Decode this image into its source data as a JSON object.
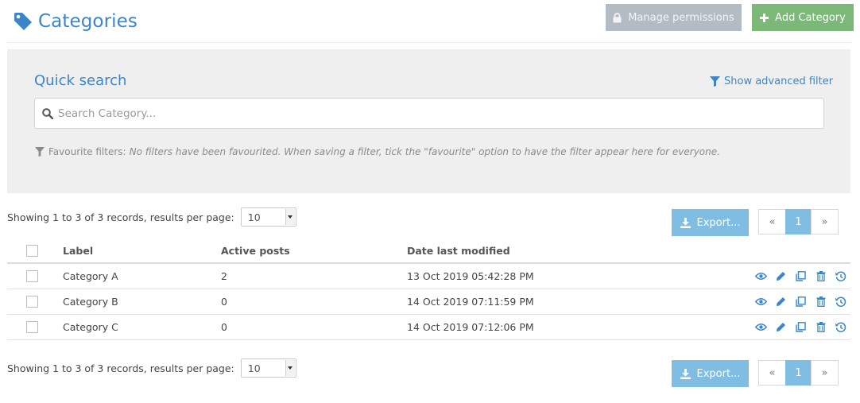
{
  "header": {
    "title": "Categories",
    "manage_permissions_label": "Manage permissions",
    "add_category_label": "Add Category"
  },
  "quick_search": {
    "title": "Quick search",
    "advanced_filter_label": "Show advanced filter",
    "search_placeholder": "Search Category...",
    "search_value": "",
    "favourite_label": "Favourite filters:",
    "favourite_text": "No filters have been favourited. When saving a filter, tick the \"favourite\" option to have the filter appear here for everyone."
  },
  "records_top": {
    "showing_text": "Showing 1 to 3 of 3 records,  results per page:",
    "per_page": "10",
    "export_label": "Export...",
    "pager": {
      "first": "«",
      "current": "1",
      "last": "»"
    }
  },
  "records_bottom": {
    "showing_text": "Showing 1 to 3 of 3 records,  results per page:",
    "per_page": "10",
    "export_label": "Export...",
    "pager": {
      "first": "«",
      "current": "1",
      "last": "»"
    }
  },
  "table": {
    "columns": {
      "label": "Label",
      "active_posts": "Active posts",
      "date_modified": "Date last modified"
    },
    "rows": [
      {
        "label": "Category A",
        "active_posts": "2",
        "date_modified": "13 Oct 2019 05:42:28 PM"
      },
      {
        "label": "Category B",
        "active_posts": "0",
        "date_modified": "14 Oct 2019 07:11:59 PM"
      },
      {
        "label": "Category C",
        "active_posts": "0",
        "date_modified": "14 Oct 2019 07:12:06 PM"
      }
    ],
    "row_actions": [
      "view-icon",
      "edit-icon",
      "copy-icon",
      "delete-icon",
      "history-icon"
    ]
  },
  "colors": {
    "accent_blue": "#3a86c8",
    "add_green": "#7cb878",
    "manage_grey": "#b4bcc3",
    "export_blue": "#7fbde3",
    "panel_bg": "#efefef"
  }
}
